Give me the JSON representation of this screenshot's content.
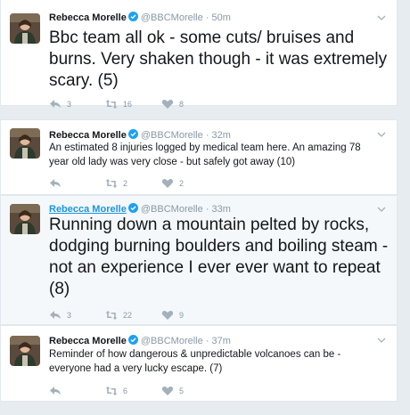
{
  "colors": {
    "name": "#14171a",
    "muted": "#8899a6",
    "link": "#1b95e0",
    "verified": "#1da1f2",
    "background": "#e6ecf0",
    "card": "#ffffff",
    "card_hover": "#f5f8fa"
  },
  "icons": {
    "verified": "verified-badge-icon",
    "reply": "reply-icon",
    "retweet": "retweet-icon",
    "like": "heart-icon",
    "menu": "chevron-down-icon"
  },
  "tweets": [
    {
      "name": "Rebecca Morelle",
      "handle": "@BBCMorelle",
      "dot": "·",
      "time": "50m",
      "text": "Bbc team all ok - some cuts/ bruises and burns. Very shaken though - it was extremely scary. (5)",
      "reply_count": "3",
      "retweet_count": "16",
      "like_count": "8"
    },
    {
      "name": "Rebecca Morelle",
      "handle": "@BBCMorelle",
      "dot": "·",
      "time": "32m",
      "text": "An estimated 8 injuries logged by medical team here. An amazing 78 year old lady was very close - but safely got away (10)",
      "reply_count": "",
      "retweet_count": "2",
      "like_count": "2"
    },
    {
      "name": "Rebecca Morelle",
      "handle": "@BBCMorelle",
      "dot": "·",
      "time": "33m",
      "text": "Running down a mountain pelted by rocks, dodging burning boulders  and boiling steam - not an experience I ever ever want to repeat (8)",
      "reply_count": "3",
      "retweet_count": "22",
      "like_count": "9"
    },
    {
      "name": "Rebecca Morelle",
      "handle": "@BBCMorelle",
      "dot": "·",
      "time": "37m",
      "text": "Reminder of how dangerous & unpredictable volcanoes can be - everyone had a very lucky escape. (7)",
      "reply_count": "",
      "retweet_count": "6",
      "like_count": "5"
    }
  ]
}
